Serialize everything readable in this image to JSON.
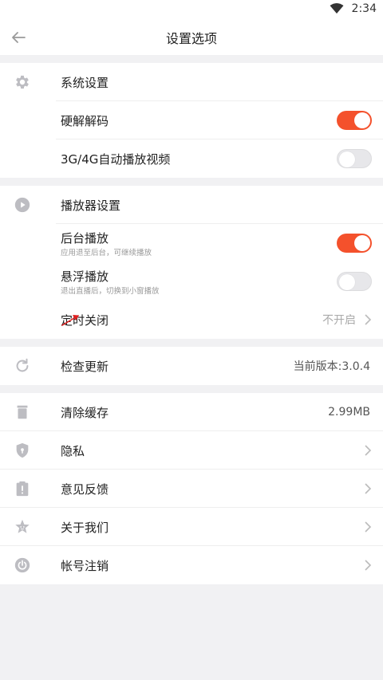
{
  "status": {
    "time": "2:34"
  },
  "header": {
    "title": "设置选项"
  },
  "player_settings_section": {
    "title": "播放器设置",
    "background_play": {
      "label": "后台播放",
      "desc": "应用退至后台，可继续播放",
      "on": true
    },
    "float_play": {
      "label": "悬浮播放",
      "desc": "退出直播后，切换到小窗播放",
      "on": false
    },
    "timer_close": {
      "label": "定时关闭",
      "value": "不开启"
    }
  },
  "system_section": {
    "title": "系统设置",
    "hw_decode": {
      "label": "硬解解码",
      "on": true
    },
    "auto_play": {
      "label": "3G/4G自动播放视频",
      "on": false
    }
  },
  "check_update": {
    "label": "检查更新",
    "value": "当前版本:3.0.4"
  },
  "list": {
    "clear_cache": {
      "label": "清除缓存",
      "value": "2.99MB"
    },
    "privacy": {
      "label": "隐私"
    },
    "feedback": {
      "label": "意见反馈"
    },
    "about": {
      "label": "关于我们"
    },
    "account_cancel": {
      "label": "帐号注销"
    }
  },
  "colors": {
    "accent": "#f4512c",
    "icon_gray": "#bdbdc2"
  }
}
